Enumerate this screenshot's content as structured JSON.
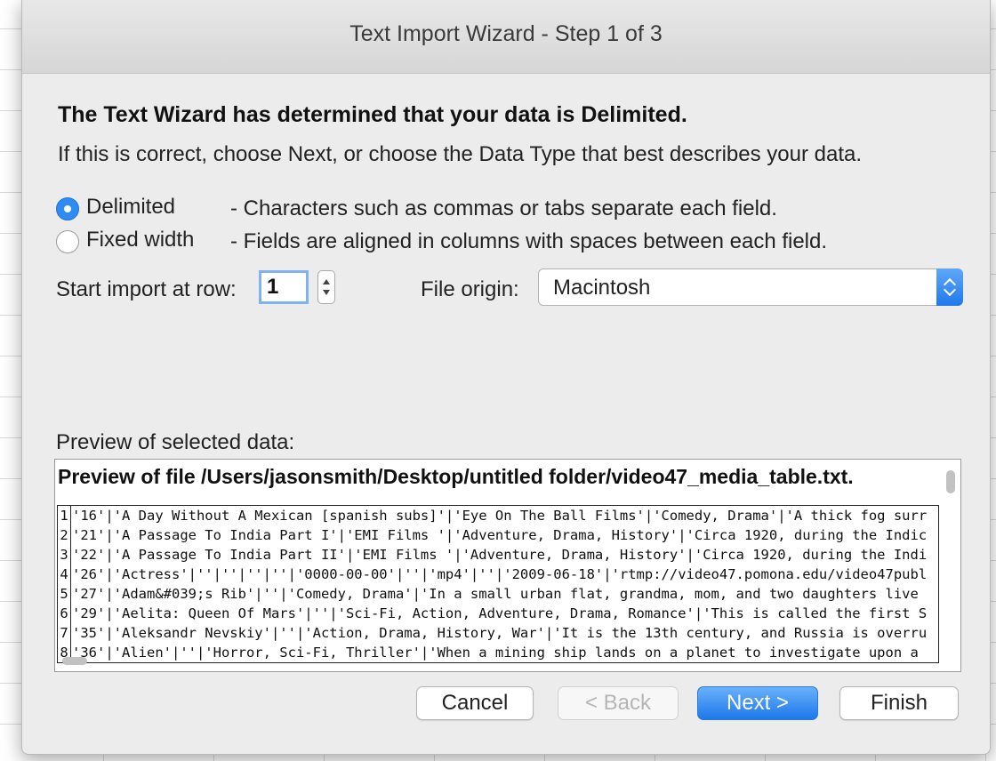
{
  "window": {
    "title": "Text Import Wizard - Step 1 of 3"
  },
  "intro": {
    "heading": "The Text Wizard has determined that your data is Delimited.",
    "subtext": "If this is correct, choose Next, or choose the Data Type that best describes your data."
  },
  "data_type": {
    "options": [
      {
        "label": "Delimited",
        "description": "- Characters such as commas or tabs separate each field.",
        "selected": true
      },
      {
        "label": "Fixed width",
        "description": "- Fields are aligned in columns with spaces between each field.",
        "selected": false
      }
    ]
  },
  "start_row": {
    "label": "Start import at row:",
    "value": "1"
  },
  "file_origin": {
    "label": "File origin:",
    "value": "Macintosh"
  },
  "preview": {
    "label": "Preview of selected data:",
    "file_title": "Preview of file /Users/jasonsmith/Desktop/untitled folder/video47_media_table.txt.",
    "lines": [
      {
        "num": "1",
        "text": "'16'|'A Day Without A Mexican [spanish subs]'|'Eye On The Ball Films'|'Comedy, Drama'|'A thick fog surr"
      },
      {
        "num": "2",
        "text": "'21'|'A Passage To India Part I'|'EMI Films '|'Adventure, Drama, History'|'Circa 1920, during the Indic"
      },
      {
        "num": "3",
        "text": "'22'|'A Passage To India Part II'|'EMI Films '|'Adventure, Drama, History'|'Circa 1920, during the Indi"
      },
      {
        "num": "4",
        "text": "'26'|'Actress'|''|''|''|''|'0000-00-00'|''|'mp4'|''|'2009-06-18'|'rtmp://video47.pomona.edu/video47publ"
      },
      {
        "num": "5",
        "text": "'27'|'Adam&#039;s Rib'|''|'Comedy, Drama'|'In a small urban flat, grandma, mom, and two daughters live"
      },
      {
        "num": "6",
        "text": "'29'|'Aelita: Queen Of Mars'|''|'Sci-Fi, Action, Adventure, Drama, Romance'|'This is called the first S"
      },
      {
        "num": "7",
        "text": "'35'|'Aleksandr Nevskiy'|''|'Action, Drama, History, War'|'It is the 13th century, and Russia is overru"
      },
      {
        "num": "8",
        "text": "'36'|'Alien'|''|'Horror, Sci-Fi, Thriller'|'When a mining ship lands on a planet to investigate upon a"
      }
    ]
  },
  "buttons": {
    "cancel": "Cancel",
    "back": "< Back",
    "next": "Next >",
    "finish": "Finish"
  },
  "colors": {
    "accent": "#2f8cf5",
    "dialog_bg": "#ececec",
    "disabled_text": "#b5b5b5"
  }
}
